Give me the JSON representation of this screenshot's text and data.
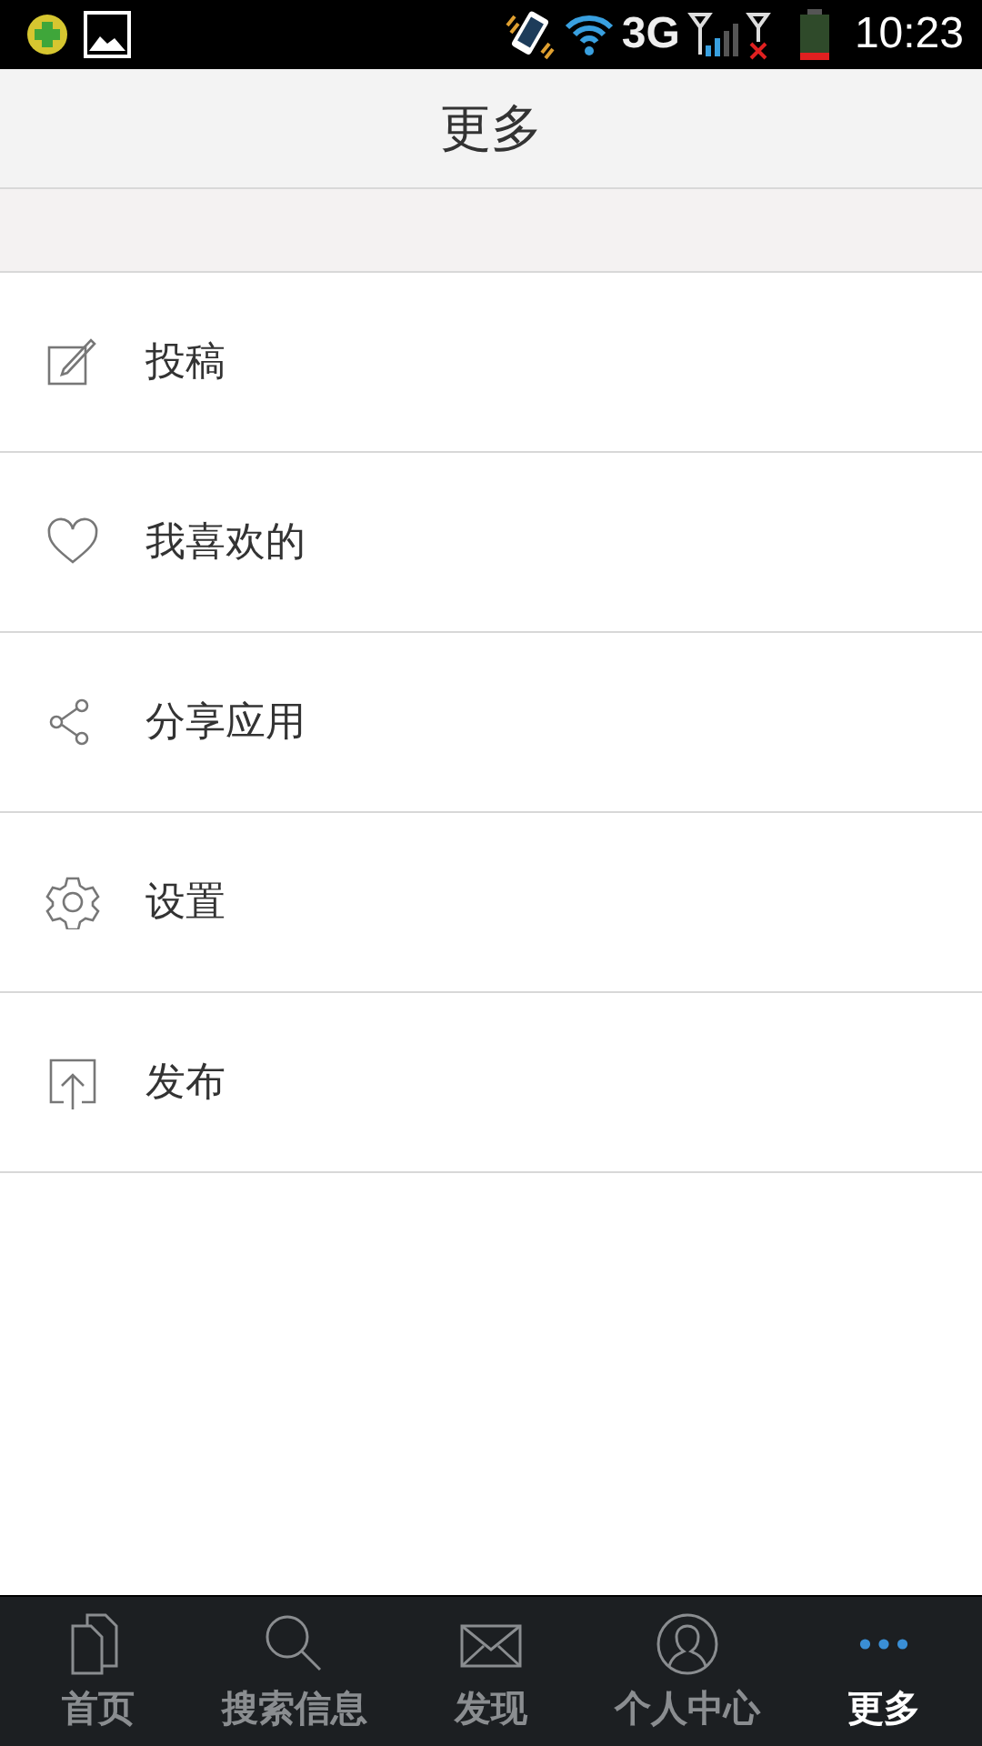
{
  "status_bar": {
    "network": "3G",
    "time": "10:23"
  },
  "header": {
    "title": "更多"
  },
  "menu": [
    {
      "kind": "compose",
      "label": "投稿"
    },
    {
      "kind": "heart",
      "label": "我喜欢的"
    },
    {
      "kind": "share",
      "label": "分享应用"
    },
    {
      "kind": "gear",
      "label": "设置"
    },
    {
      "kind": "upload",
      "label": "发布"
    }
  ],
  "tabs": [
    {
      "kind": "pages",
      "label": "首页",
      "selected": false
    },
    {
      "kind": "search",
      "label": "搜索信息",
      "selected": false
    },
    {
      "kind": "mail",
      "label": "发现",
      "selected": false
    },
    {
      "kind": "person",
      "label": "个人中心",
      "selected": false
    },
    {
      "kind": "dots",
      "label": "更多",
      "selected": true
    }
  ]
}
